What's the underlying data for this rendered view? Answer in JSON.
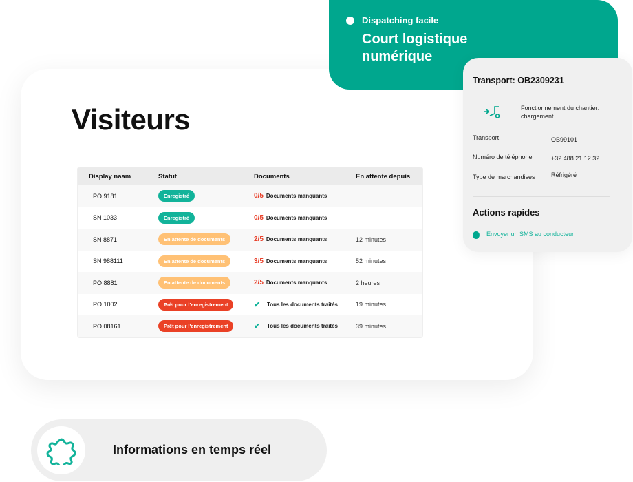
{
  "visitors": {
    "title": "Visiteurs",
    "columns": [
      "Display naam",
      "Statut",
      "Documents",
      "En attente depuis"
    ],
    "rows": [
      {
        "name": "PO 9181",
        "status": "Enregistré",
        "status_color": "#12b39a",
        "docs_count": "0/5",
        "docs": "Documents manquants",
        "waiting": "",
        "complete": false
      },
      {
        "name": "SN 1033",
        "status": "Enregistré",
        "status_color": "#12b39a",
        "docs_count": "0/5",
        "docs": "Documents manquants",
        "waiting": "",
        "complete": false
      },
      {
        "name": "SN 8871",
        "status": "En attente de documents",
        "status_color": "#ffc175",
        "docs_count": "2/5",
        "docs": "Documents manquants",
        "waiting": "12 minutes",
        "complete": false
      },
      {
        "name": "SN 988111",
        "status": "En attente de documents",
        "status_color": "#ffc175",
        "docs_count": "3/5",
        "docs": "Documents manquants",
        "waiting": "52 minutes",
        "complete": false
      },
      {
        "name": "PO 8881",
        "status": "En attente de documents",
        "status_color": "#ffc175",
        "docs_count": "2/5",
        "docs": "Documents manquants",
        "waiting": "2 heures",
        "complete": false
      },
      {
        "name": "PO 1002",
        "status": "Prêt pour l'enregistrement",
        "status_color": "#ea4126",
        "docs_count": "",
        "docs": "Tous les documents traités",
        "waiting": "19 minutes",
        "complete": true
      },
      {
        "name": "PO 08161",
        "status": "Prêt pour l'enregistrement",
        "status_color": "#ea4126",
        "docs_count": "",
        "docs": "Tous les documents traités",
        "waiting": "39 minutes",
        "complete": true
      }
    ]
  },
  "promo": {
    "subtitle": "Dispatching facile",
    "title_line1": "Court logistique",
    "title_line2": "numérique",
    "color": "#00a78e"
  },
  "transport": {
    "title": "Transport: OB2309231",
    "operation_icon": "loading-truck-icon",
    "operation": "Fonctionnement du chantier:",
    "operation_value": "chargement",
    "fields": [
      {
        "label": "Transport",
        "value": "OB99101"
      },
      {
        "label": "Numéro de téléphone",
        "value": "+32 488 21 12 32"
      },
      {
        "label": "Type de marchandises",
        "value": "Réfrigéré"
      }
    ],
    "actions_title": "Actions rapides",
    "action_sms": "Envoyer un SMS au conducteur"
  },
  "feature": {
    "icon": "gear-icon",
    "label": "Informations en temps réel"
  }
}
